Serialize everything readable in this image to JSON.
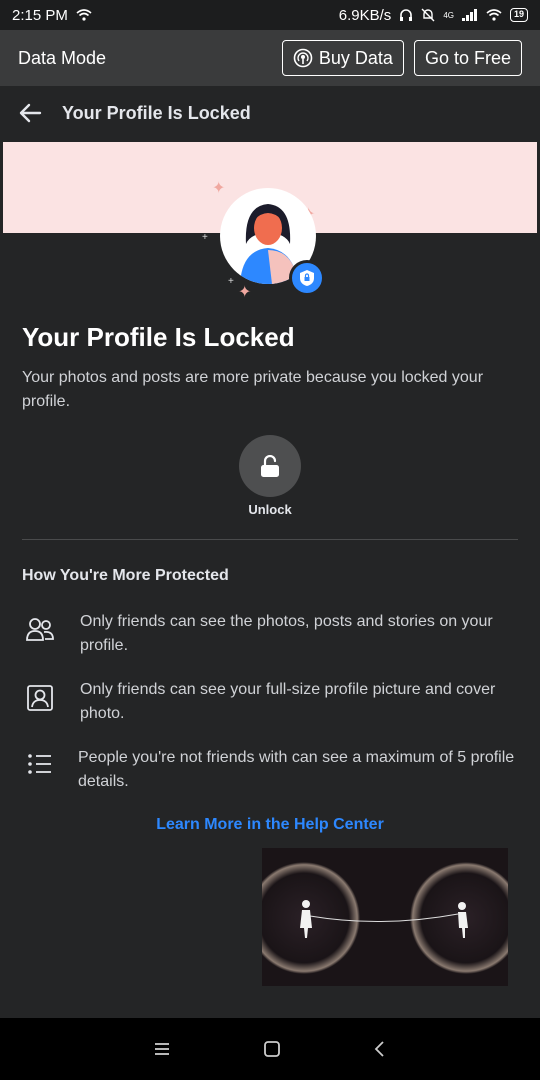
{
  "status": {
    "time": "2:15 PM",
    "speed": "6.9KB/s",
    "network": "4G",
    "battery": "19"
  },
  "data_bar": {
    "title": "Data Mode",
    "buy_label": "Buy Data",
    "free_label": "Go to Free"
  },
  "nav": {
    "title": "Your Profile Is Locked"
  },
  "main": {
    "heading": "Your Profile Is Locked",
    "description": "Your photos and posts are more private because you locked your profile.",
    "unlock_label": "Unlock",
    "section_title": "How You're More Protected",
    "items": [
      {
        "icon": "friends-icon",
        "text": "Only friends can see the photos, posts and stories on your profile."
      },
      {
        "icon": "profile-picture-icon",
        "text": "Only friends can see your full-size profile picture and cover photo."
      },
      {
        "icon": "list-icon",
        "text": "People you're not friends with can see a maximum of 5 profile details."
      }
    ],
    "help_link": "Learn More in the Help Center"
  },
  "colors": {
    "background": "#242526",
    "banner": "#fbe3e3",
    "accent": "#2d88ff"
  }
}
